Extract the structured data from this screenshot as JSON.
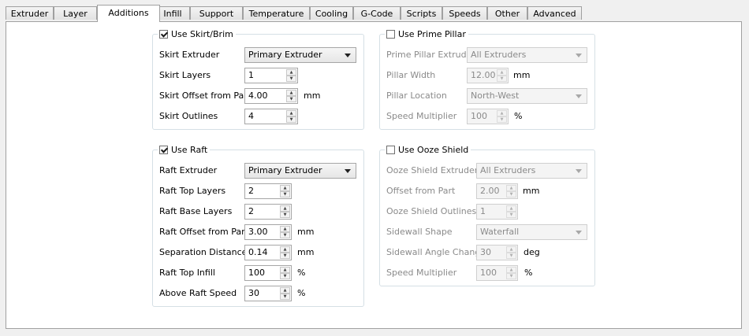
{
  "tabs": [
    "Extruder",
    "Layer",
    "Additions",
    "Infill",
    "Support",
    "Temperature",
    "Cooling",
    "G-Code",
    "Scripts",
    "Speeds",
    "Other",
    "Advanced"
  ],
  "active_tab": "Additions",
  "skirt": {
    "title": "Use Skirt/Brim",
    "checked": true,
    "extruder_label": "Skirt Extruder",
    "extruder_value": "Primary Extruder",
    "layers_label": "Skirt Layers",
    "layers_value": "1",
    "offset_label": "Skirt Offset from Part",
    "offset_value": "4.00",
    "offset_unit": "mm",
    "outlines_label": "Skirt Outlines",
    "outlines_value": "4"
  },
  "raft": {
    "title": "Use Raft",
    "checked": true,
    "extruder_label": "Raft Extruder",
    "extruder_value": "Primary Extruder",
    "top_layers_label": "Raft Top Layers",
    "top_layers_value": "2",
    "base_layers_label": "Raft Base Layers",
    "base_layers_value": "2",
    "offset_label": "Raft Offset from Part",
    "offset_value": "3.00",
    "offset_unit": "mm",
    "separation_label": "Separation Distance",
    "separation_value": "0.14",
    "separation_unit": "mm",
    "top_infill_label": "Raft Top Infill",
    "top_infill_value": "100",
    "top_infill_unit": "%",
    "above_speed_label": "Above Raft Speed",
    "above_speed_value": "30",
    "above_speed_unit": "%"
  },
  "prime": {
    "title": "Use Prime Pillar",
    "checked": false,
    "extruder_label": "Prime Pillar Extruder",
    "extruder_value": "All Extruders",
    "width_label": "Pillar Width",
    "width_value": "12.00",
    "width_unit": "mm",
    "location_label": "Pillar Location",
    "location_value": "North-West",
    "speed_label": "Speed Multiplier",
    "speed_value": "100",
    "speed_unit": "%"
  },
  "ooze": {
    "title": "Use Ooze Shield",
    "checked": false,
    "extruder_label": "Ooze Shield Extruder",
    "extruder_value": "All Extruders",
    "offset_label": "Offset from Part",
    "offset_value": "2.00",
    "offset_unit": "mm",
    "outlines_label": "Ooze Shield Outlines",
    "outlines_value": "1",
    "sidewall_label": "Sidewall Shape",
    "sidewall_value": "Waterfall",
    "angle_label": "Sidewall Angle Change",
    "angle_value": "30",
    "angle_unit": "deg",
    "speed_label": "Speed Multiplier",
    "speed_value": "100",
    "speed_unit": "%"
  }
}
